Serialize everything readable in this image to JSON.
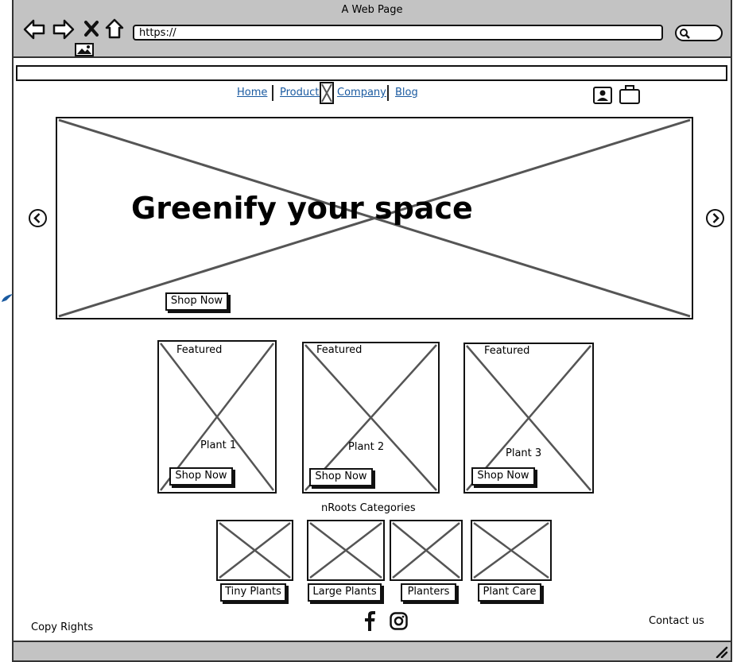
{
  "browser": {
    "title": "A Web Page",
    "url": "https://"
  },
  "nav": {
    "items": [
      "Home",
      "Products",
      "Company",
      "Blog"
    ]
  },
  "hero": {
    "heading": "Greenify your space",
    "button": "Shop Now"
  },
  "featured": [
    {
      "tag": "Featured",
      "name": "Plant 1",
      "button": "Shop Now"
    },
    {
      "tag": "Featured",
      "name": "Plant 2",
      "button": "Shop Now"
    },
    {
      "tag": "Featured",
      "name": "Plant 3",
      "button": "Shop Now"
    }
  ],
  "categories": {
    "title": "nRoots Categories",
    "items": [
      "Tiny Plants",
      "Large Plants",
      "Planters",
      "Plant Care"
    ]
  },
  "footer": {
    "copyright": "Copy Rights",
    "contact": "Contact us"
  },
  "icons": {
    "back": "back-arrow-icon",
    "forward": "forward-arrow-icon",
    "close": "close-icon",
    "home": "home-icon",
    "image": "image-icon",
    "search": "search-icon",
    "user": "user-icon",
    "bag": "shopping-bag-icon",
    "prev": "chevron-left-icon",
    "next": "chevron-right-icon",
    "facebook": "facebook-icon",
    "instagram": "instagram-icon",
    "resize": "resize-grip-icon"
  },
  "colors": {
    "link": "#1a5aa0",
    "chrome": "#c3c3c3",
    "placeholder_cross": "#555555"
  }
}
